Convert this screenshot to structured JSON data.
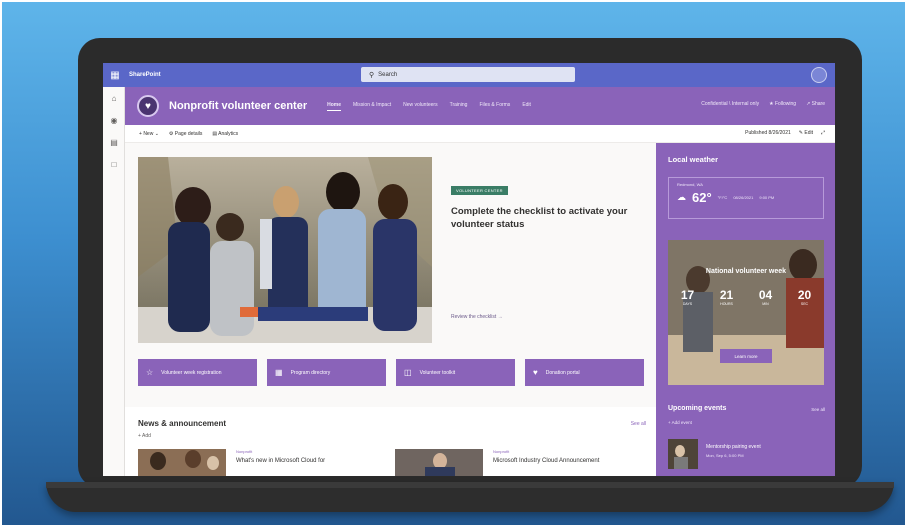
{
  "suitebar": {
    "app_name": "SharePoint",
    "search_placeholder": "Search",
    "avatar_initial": ""
  },
  "site": {
    "title": "Nonprofit volunteer center",
    "nav": [
      "Home",
      "Mission & Impact",
      "New volunteers",
      "Training",
      "Files & Forms",
      "Edit"
    ],
    "header_right": [
      "Confidential \\ Internal only",
      "Following",
      "Share"
    ]
  },
  "cmdbar": {
    "items": [
      "New",
      "Page details",
      "Analytics"
    ],
    "published": "Published 8/26/2021",
    "edit": "Edit"
  },
  "hero": {
    "tag": "VOLUNTEER CENTER",
    "title": "Complete the checklist to activate your volunteer status",
    "link": "Review the checklist →"
  },
  "quick_links": [
    {
      "label": "Volunteer week registration",
      "icon": "star-icon"
    },
    {
      "label": "Program directory",
      "icon": "document-icon"
    },
    {
      "label": "Volunteer toolkit",
      "icon": "toolbox-icon"
    },
    {
      "label": "Donation portal",
      "icon": "heart-icon"
    }
  ],
  "news": {
    "title": "News & announcement",
    "add": "+ Add",
    "see_all": "See all",
    "items": [
      {
        "category": "Nonprofit",
        "headline": "What's new in Microsoft Cloud for"
      },
      {
        "category": "Nonprofit",
        "headline": "Microsoft Industry Cloud Announcement"
      }
    ]
  },
  "weather": {
    "title": "Local weather",
    "location": "Redmond, WA",
    "temp": "62°",
    "unit": "°F/°C",
    "date": "08/26/2021",
    "time": "9:00 PM"
  },
  "promo": {
    "title": "National volunteer week",
    "countdown": [
      {
        "num": "17",
        "label": "DAYS"
      },
      {
        "num": "21",
        "label": "HOURS"
      },
      {
        "num": "04",
        "label": "MIN"
      },
      {
        "num": "20",
        "label": "SEC"
      }
    ],
    "button": "Learn more"
  },
  "events": {
    "title": "Upcoming events",
    "see_all": "See all",
    "add": "+ Add event",
    "items": [
      {
        "name": "Mentorship pairing event",
        "date": "Mon, Sep 6, 5:00 PM"
      }
    ]
  }
}
